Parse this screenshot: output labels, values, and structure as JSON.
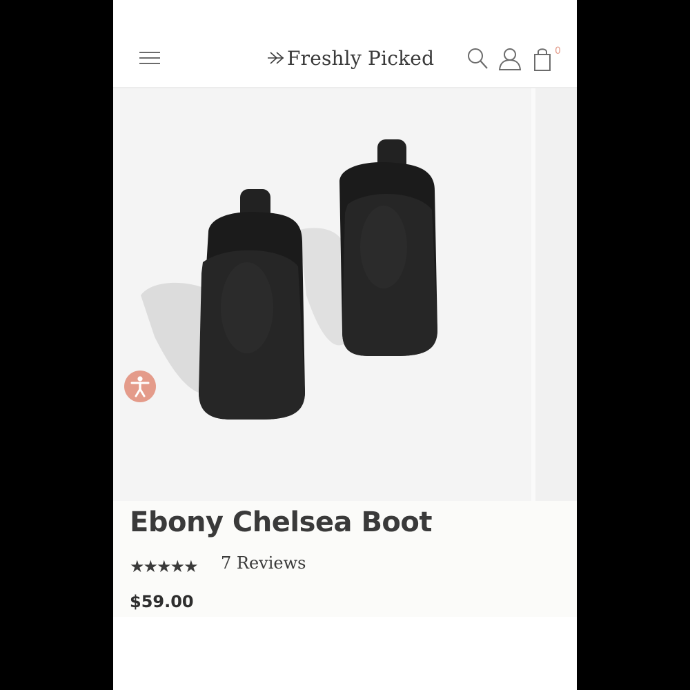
{
  "brand": {
    "logo_text": "Freshly Picked"
  },
  "header": {
    "cart_count": "0"
  },
  "product": {
    "title": "Ebony Chelsea Boot",
    "rating": 5,
    "rating_max": 5,
    "rating_stars": "★★★★★",
    "reviews": "7 Reviews",
    "price": "$59.00"
  },
  "colors": {
    "accent": "#e49b8a",
    "text": "#3a3a3a",
    "image_background": "#f4f4f4",
    "boot": "#1e1e1e"
  },
  "icons": [
    "hamburger-menu-icon",
    "logo-arrow-icon",
    "search-icon",
    "account-icon",
    "shopping-bag-icon",
    "accessibility-icon"
  ]
}
